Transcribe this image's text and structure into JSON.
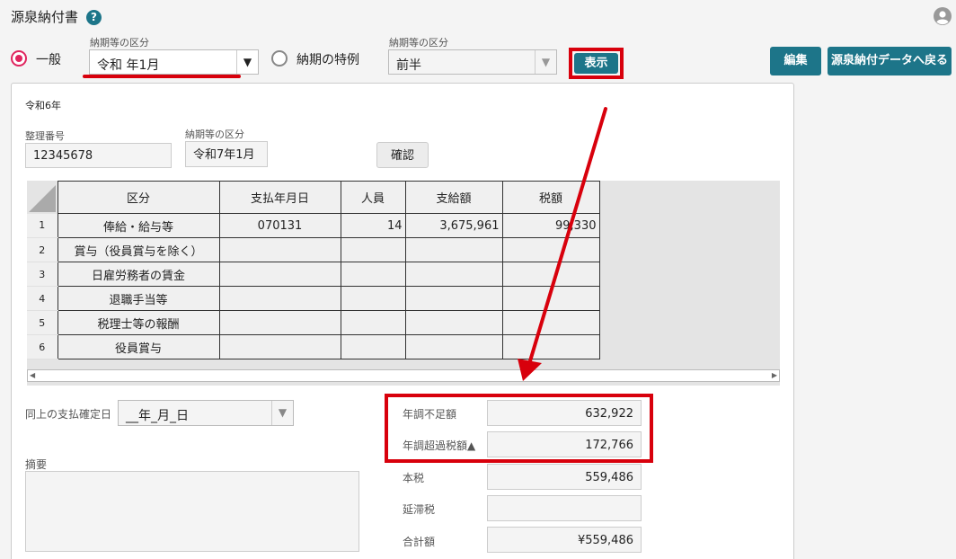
{
  "header": {
    "title": "源泉納付書",
    "help_icon": "?"
  },
  "mode": {
    "general_label": "一般",
    "special_label": "納期の特例",
    "period_label_1": "納期等の区分",
    "period_value_1": "令和 年1月",
    "period_label_2": "納期等の区分",
    "period_value_2": "前半",
    "show_button": "表示"
  },
  "actions": {
    "edit": "編集",
    "back": "源泉納付データへ戻る"
  },
  "form": {
    "era_year": "令和6年",
    "ref_label": "整理番号",
    "ref_value": "12345678",
    "period_label": "納期等の区分",
    "period_value": "令和7年1月",
    "confirm_button": "確認"
  },
  "table": {
    "headers": [
      "区分",
      "支払年月日",
      "人員",
      "支給額",
      "税額"
    ],
    "rows": [
      {
        "no": "1",
        "category": "俸給・給与等",
        "date": "070131",
        "people": "14",
        "amount": "3,675,961",
        "tax": "99,330"
      },
      {
        "no": "2",
        "category": "賞与（役員賞与を除く）",
        "date": "",
        "people": "",
        "amount": "",
        "tax": ""
      },
      {
        "no": "3",
        "category": "日雇労務者の賃金",
        "date": "",
        "people": "",
        "amount": "",
        "tax": ""
      },
      {
        "no": "4",
        "category": "退職手当等",
        "date": "",
        "people": "",
        "amount": "",
        "tax": ""
      },
      {
        "no": "5",
        "category": "税理士等の報酬",
        "date": "",
        "people": "",
        "amount": "",
        "tax": ""
      },
      {
        "no": "6",
        "category": "役員賞与",
        "date": "",
        "people": "",
        "amount": "",
        "tax": ""
      }
    ]
  },
  "bottom": {
    "pay_date_label": "同上の支払確定日",
    "pay_date_value": "__年_月_日",
    "memo_label": "摘要",
    "shortage_label": "年調不足額",
    "shortage_value": "632,922",
    "excess_label": "年調超過税額▲",
    "excess_value": "172,766",
    "main_tax_label": "本税",
    "main_tax_value": "559,486",
    "delay_tax_label": "延滞税",
    "delay_tax_value": "",
    "total_label": "合計額",
    "total_value": "¥559,486"
  },
  "colors": {
    "accent": "#1d7589",
    "highlight": "#d8000c",
    "radio": "#e0245e"
  }
}
